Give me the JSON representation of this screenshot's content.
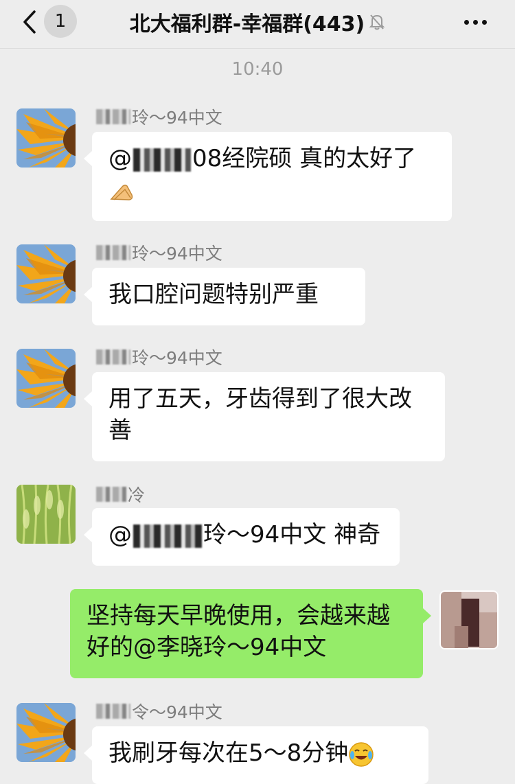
{
  "header": {
    "back_icon": "chevron-left-icon",
    "unread_count": "1",
    "title": "北大福利群-幸福群(443)",
    "mute_icon": "bell-off-icon",
    "more_icon": "more-dots-icon"
  },
  "timestamp": "10:40",
  "messages": [
    {
      "sender": "玲～94中文",
      "text_before": "@",
      "text_after": "08经院硕 真的太好了",
      "emoji": "pray-hands-emoji",
      "avatar": "sunflower"
    },
    {
      "sender": "玲～94中文",
      "text": "我口腔问题特别严重",
      "avatar": "sunflower"
    },
    {
      "sender": "玲～94中文",
      "text": "用了五天，牙齿得到了很大改善",
      "avatar": "sunflower"
    },
    {
      "sender": "冷",
      "text_before": "@",
      "text_after": "玲～94中文 神奇",
      "avatar": "wheat"
    },
    {
      "sender": "",
      "text": "坚持每天早晚使用，会越来越好的@李晓玲～94中文",
      "avatar": "self-blurred",
      "outgoing": true
    },
    {
      "sender": "令～94中文",
      "text": "我刷牙每次在5～8分钟",
      "emoji": "crying-laughing-emoji",
      "avatar": "sunflower"
    }
  ]
}
